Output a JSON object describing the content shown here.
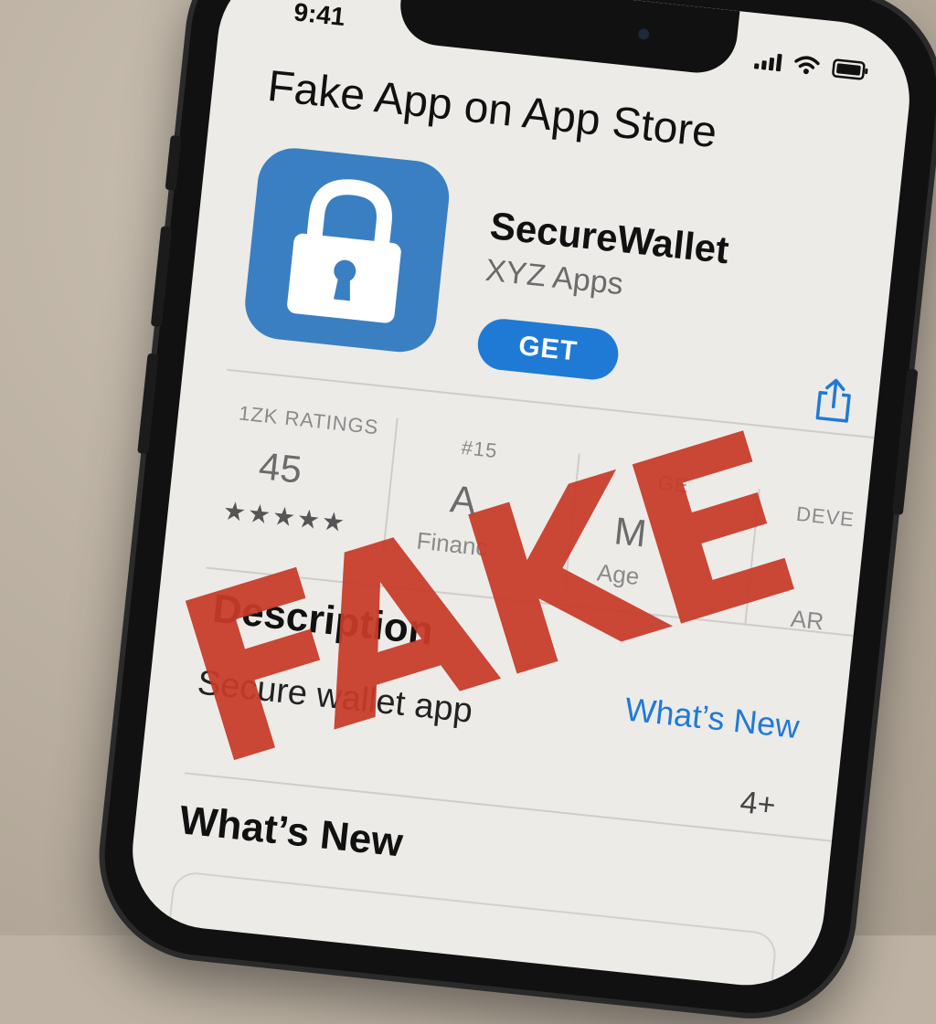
{
  "status_bar": {
    "time": "9:41"
  },
  "page": {
    "title": "Fake App on App Store"
  },
  "app": {
    "name": "SecureWallet",
    "developer": "XYZ Apps",
    "get_label": "GET",
    "icon": "lock-icon",
    "icon_color": "#3a7fc1"
  },
  "stats": {
    "ratings": {
      "label": "1ZK RATINGS",
      "value": "45",
      "stars": "★★★★★"
    },
    "chart": {
      "label": "#15",
      "value": "A",
      "sub": "Financ"
    },
    "age": {
      "label": "GE",
      "value": "M",
      "sub": "Age"
    },
    "developer": {
      "label": "DEVE",
      "sub": "AR"
    }
  },
  "description": {
    "title": "Description",
    "text": "Secure wallet app",
    "whats_new_link": "What’s New",
    "age_rating": "4+"
  },
  "whats_new": {
    "title": "What’s New"
  },
  "stamp": {
    "text": "FAKE",
    "color": "#c83a28"
  },
  "colors": {
    "accent": "#1f7ad6",
    "screen_bg": "#ecebe8"
  }
}
